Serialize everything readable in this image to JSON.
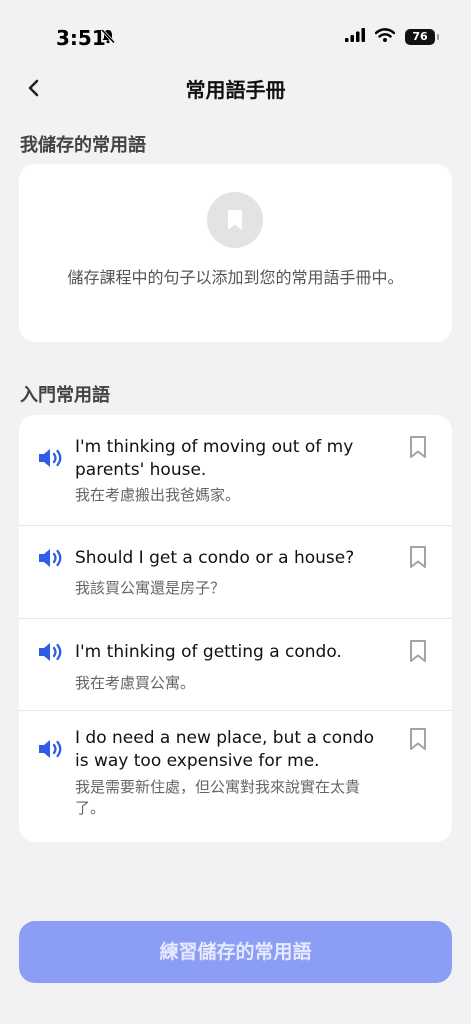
{
  "status_bar": {
    "time": "3:51",
    "battery": "76"
  },
  "header": {
    "title": "常用語手冊"
  },
  "saved_section": {
    "label": "我儲存的常用語",
    "empty_text": "儲存課程中的句子以添加到您的常用語手冊中。"
  },
  "beginner_section": {
    "label": "入門常用語",
    "phrases": [
      {
        "en": "I'm thinking of moving out of my parents' house.",
        "zh": "我在考慮搬出我爸媽家。"
      },
      {
        "en": "Should I get a condo or a house?",
        "zh": "我該買公寓還是房子？"
      },
      {
        "en": "I'm thinking of getting a condo.",
        "zh": "我在考慮買公寓。"
      },
      {
        "en": "I do need a new place, but a condo is way too expensive for me.",
        "zh": "我是需要新住處，但公寓對我來說實在太貴了。"
      }
    ]
  },
  "footer": {
    "practice_label": "練習儲存的常用語"
  },
  "colors": {
    "accent": "#2f5de8",
    "button": "#8c9df5",
    "background": "#f2f2f4"
  }
}
